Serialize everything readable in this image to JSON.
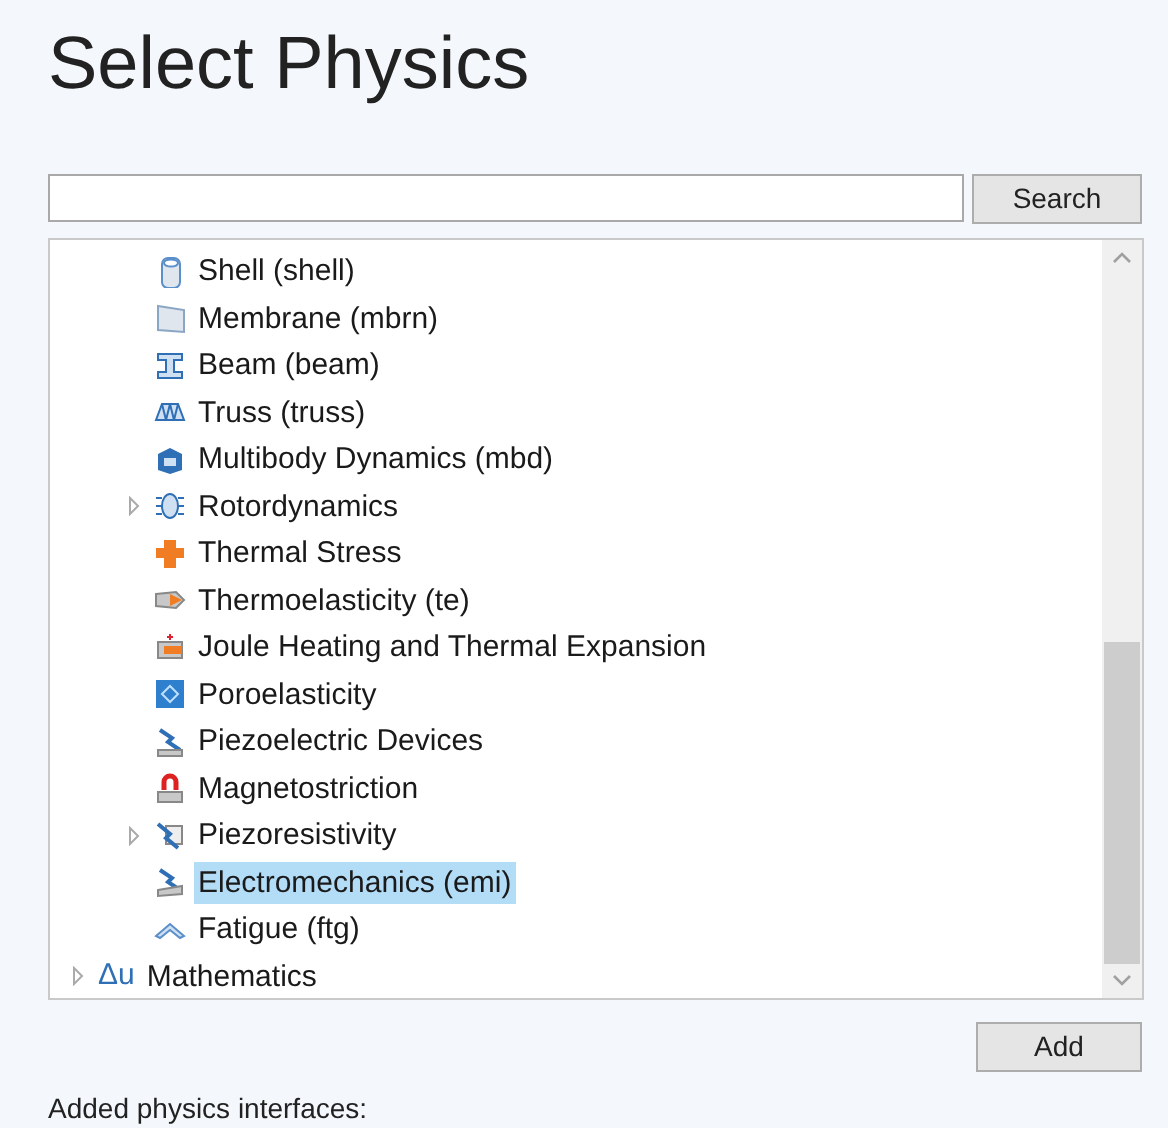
{
  "title": "Select Physics",
  "search": {
    "button": "Search"
  },
  "tree": {
    "items": [
      {
        "children": [
          {
            "label": "Shell (shell)",
            "kind": "leaf",
            "selected": false
          },
          {
            "label": "Membrane (mbrn)",
            "kind": "leaf",
            "selected": false
          },
          {
            "label": "Beam (beam)",
            "kind": "leaf",
            "selected": false
          },
          {
            "label": "Truss (truss)",
            "kind": "leaf",
            "selected": false
          },
          {
            "label": "Multibody Dynamics (mbd)",
            "kind": "leaf",
            "selected": false
          },
          {
            "label": "Rotordynamics",
            "kind": "group",
            "expanded": false,
            "selected": false
          },
          {
            "label": "Thermal Stress",
            "kind": "leaf",
            "selected": false
          },
          {
            "label": "Thermoelasticity (te)",
            "kind": "leaf",
            "selected": false
          },
          {
            "label": "Joule Heating and Thermal Expansion",
            "kind": "leaf",
            "selected": false
          },
          {
            "label": "Poroelasticity",
            "kind": "leaf",
            "selected": false
          },
          {
            "label": "Piezoelectric Devices",
            "kind": "leaf",
            "selected": false
          },
          {
            "label": "Magnetostriction",
            "kind": "leaf",
            "selected": false
          },
          {
            "label": "Piezoresistivity",
            "kind": "group",
            "expanded": false,
            "selected": false
          },
          {
            "label": "Electromechanics (emi)",
            "kind": "leaf",
            "selected": true
          },
          {
            "label": "Fatigue (ftg)",
            "kind": "leaf",
            "selected": false
          }
        ]
      },
      {
        "label": "Mathematics",
        "symbol": "Δu",
        "kind": "group",
        "expanded": false,
        "selected": false
      }
    ]
  },
  "add_button": "Add",
  "added_heading": "Added physics interfaces:"
}
